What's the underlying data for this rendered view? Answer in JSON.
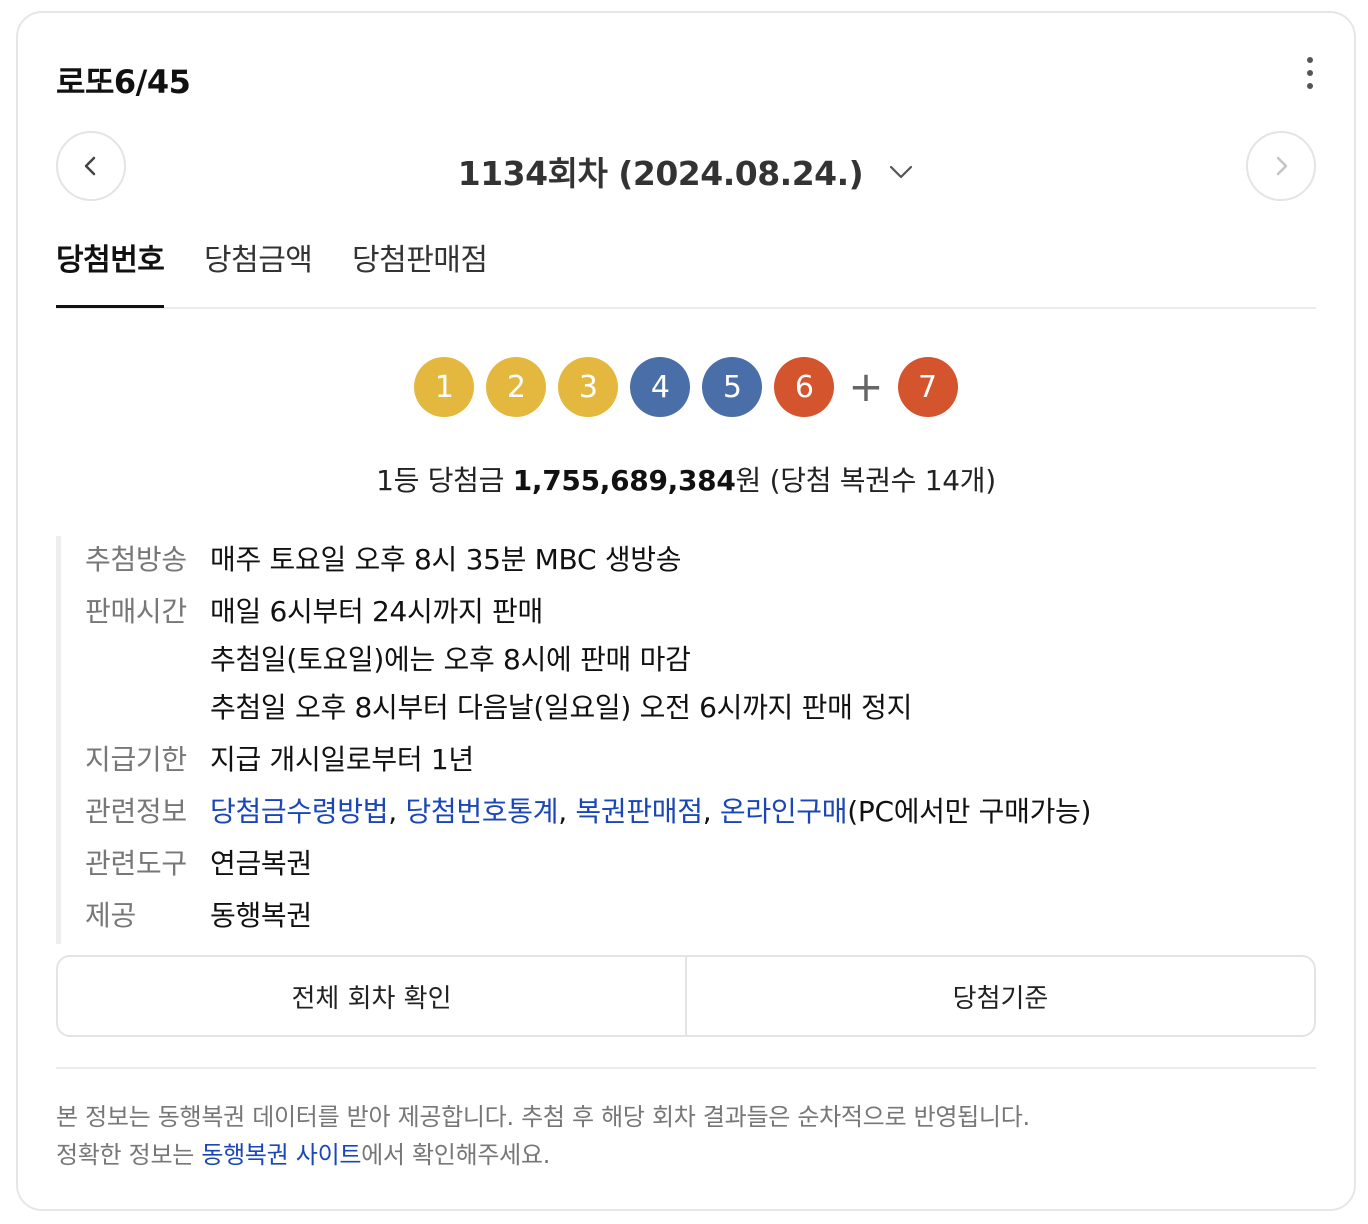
{
  "header": {
    "title": "로또6/45",
    "more_icon": "more-vertical-icon"
  },
  "round": {
    "label": "1134회차 (2024.08.24.)",
    "prev_icon": "chevron-left-icon",
    "next_icon": "chevron-right-icon",
    "dropdown_icon": "chevron-down-icon"
  },
  "tabs": [
    {
      "label": "당첨번호",
      "active": true
    },
    {
      "label": "당첨금액",
      "active": false
    },
    {
      "label": "당첨판매점",
      "active": false
    }
  ],
  "numbers": [
    {
      "value": "1",
      "color": "#e4b73f"
    },
    {
      "value": "2",
      "color": "#e4b73f"
    },
    {
      "value": "3",
      "color": "#e4b73f"
    },
    {
      "value": "4",
      "color": "#4a6ea8"
    },
    {
      "value": "5",
      "color": "#4a6ea8"
    },
    {
      "value": "6",
      "color": "#d4542d"
    }
  ],
  "plus": "+",
  "bonus": {
    "value": "7",
    "color": "#d4542d"
  },
  "prize": {
    "prefix": "1등 당첨금 ",
    "amount": "1,755,689,384",
    "suffix": "원 (당첨 복권수 14개)"
  },
  "info": {
    "broadcast": {
      "label": "추첨방송",
      "value": "매주 토요일 오후 8시 35분 MBC 생방송"
    },
    "sales_time": {
      "label": "판매시간",
      "lines": [
        "매일 6시부터 24시까지 판매",
        "추첨일(토요일)에는 오후 8시에 판매 마감",
        "추첨일 오후 8시부터 다음날(일요일) 오전 6시까지 판매 정지"
      ]
    },
    "payout": {
      "label": "지급기한",
      "value": "지급 개시일로부터 1년"
    },
    "related_info": {
      "label": "관련정보",
      "links": [
        "당첨금수령방법",
        "당첨번호통계",
        "복권판매점",
        "온라인구매"
      ],
      "separator": ", ",
      "note": "(PC에서만 구매가능)"
    },
    "related_tools": {
      "label": "관련도구",
      "link": "연금복권"
    },
    "provider": {
      "label": "제공",
      "link": "동행복권"
    }
  },
  "buttons": {
    "all_rounds": "전체 회차 확인",
    "criteria": "당첨기준"
  },
  "footer": {
    "line1": "본 정보는 동행복권 데이터를 받아 제공합니다. 추첨 후 해당 회차 결과들은 순차적으로 반영됩니다.",
    "line2_prefix": "정확한 정보는 ",
    "line2_link": "동행복권 사이트",
    "line2_suffix": "에서 확인해주세요."
  },
  "colors": {
    "link": "#1a46b8",
    "label": "#777777"
  }
}
